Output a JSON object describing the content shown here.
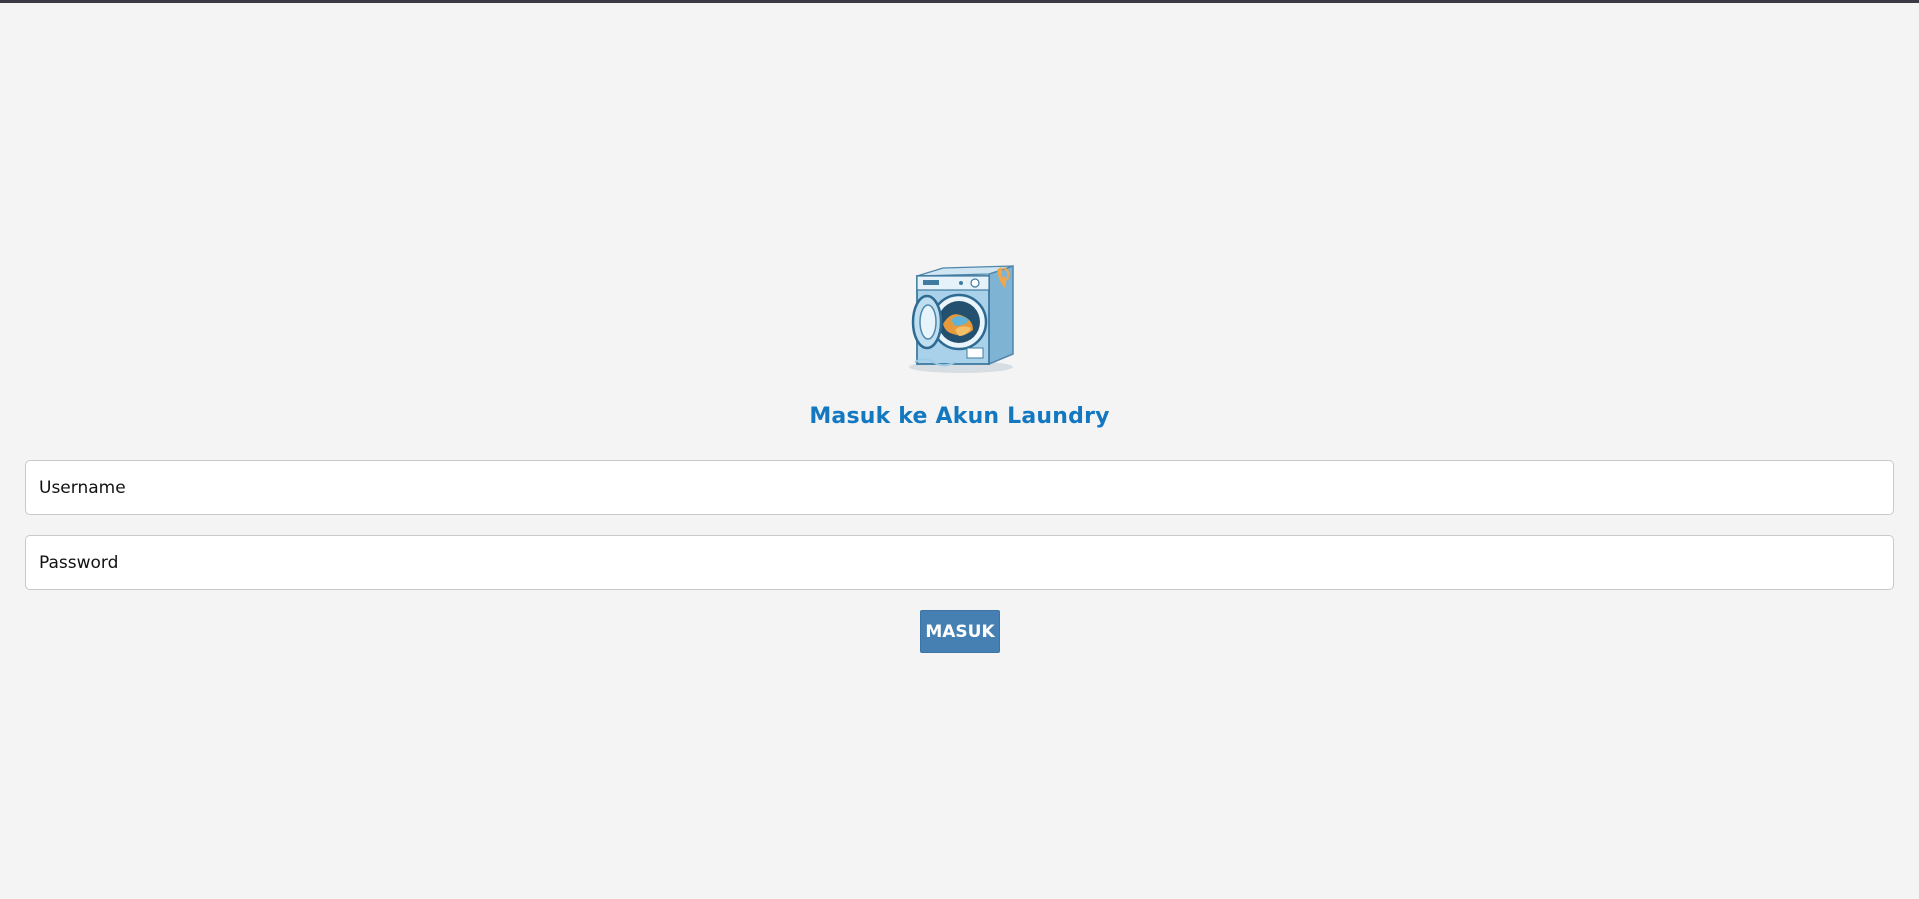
{
  "login": {
    "logo_icon": "washing-machine-icon",
    "title": "Masuk ke Akun Laundry",
    "username": {
      "placeholder": "Username",
      "value": ""
    },
    "password": {
      "placeholder": "Password",
      "value": ""
    },
    "submit_label": "MASUK"
  },
  "colors": {
    "background": "#f4f4f4",
    "title": "#1378c0",
    "button": "#4680b2",
    "button_text": "#ffffff",
    "field_border": "#c9c9c9"
  }
}
